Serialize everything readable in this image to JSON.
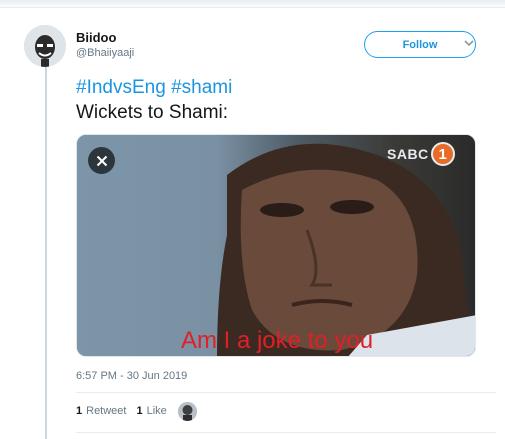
{
  "tweet": {
    "display_name": "Biidoo",
    "handle": "@Bhaiiyaaji",
    "follow_label": "Follow",
    "hashtags": [
      "#IndvsEng",
      "#shami"
    ],
    "text": "Wickets to Shami:",
    "timestamp": "6:57 PM - 30 Jun 2019",
    "retweets": {
      "count": "1",
      "label": "Retweet"
    },
    "likes": {
      "count": "1",
      "label": "Like"
    }
  },
  "media": {
    "logo_text": "SABC",
    "logo_number": "1",
    "caption": "Am I a joke to you"
  },
  "icons": {
    "close": "close-icon",
    "caret": "chevron-down-icon"
  },
  "colors": {
    "link_blue": "#1b95e0",
    "follow_border": "#1da1f2",
    "caption_red": "#e01f28",
    "logo_orange": "#e86b2a"
  }
}
